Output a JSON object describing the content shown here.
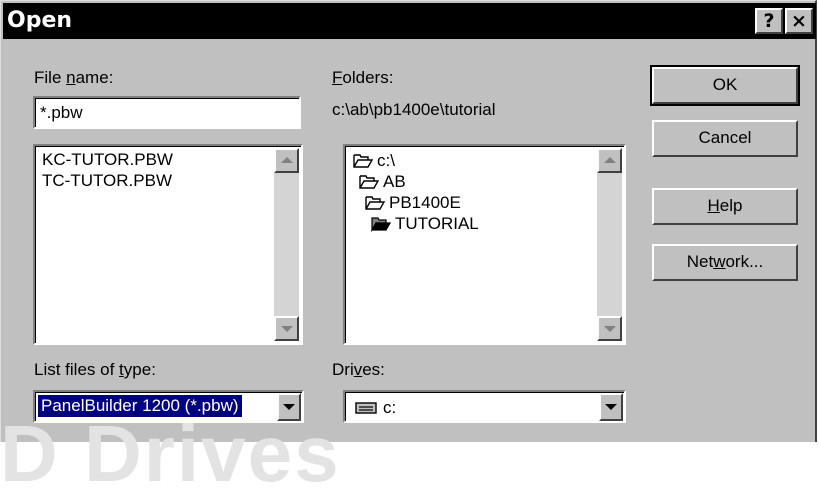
{
  "window": {
    "title": "Open",
    "help_glyph": "?",
    "close_glyph": "×"
  },
  "file_name": {
    "label_prefix": "File ",
    "label_mnemonic": "n",
    "label_suffix": "ame:",
    "value": "*.pbw"
  },
  "files": {
    "items": [
      "KC-TUTOR.PBW",
      "TC-TUTOR.PBW"
    ]
  },
  "folders": {
    "label_mnemonic": "F",
    "label_suffix": "olders:",
    "current_path": "c:\\ab\\pb1400e\\tutorial",
    "tree": [
      {
        "label": "c:\\",
        "icon": "open-folder-icon"
      },
      {
        "label": "AB",
        "icon": "open-folder-icon"
      },
      {
        "label": "PB1400E",
        "icon": "open-folder-icon"
      },
      {
        "label": "TUTORIAL",
        "icon": "open-folder-filled-icon"
      }
    ]
  },
  "file_type": {
    "label_prefix": "List files of ",
    "label_mnemonic": "t",
    "label_suffix": "ype:",
    "selected": "PanelBuilder 1200 (*.pbw)"
  },
  "drives": {
    "label_prefix": "Dri",
    "label_mnemonic": "v",
    "label_suffix": "es:",
    "selected": "c:",
    "icon": "drive-icon"
  },
  "buttons": {
    "ok": "OK",
    "cancel": "Cancel",
    "help_mnemonic": "H",
    "help_suffix": "elp",
    "network_prefix": "Net",
    "network_mnemonic": "w",
    "network_suffix": "ork..."
  },
  "watermark": "D Drives",
  "colors": {
    "dialog_bg": "#c0c0c0",
    "titlebar": "#000000",
    "selection": "#000080"
  }
}
